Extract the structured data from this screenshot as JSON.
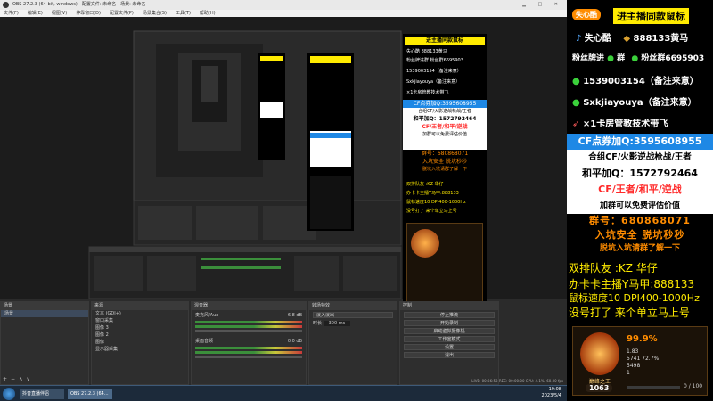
{
  "window": {
    "title": "OBS 27.2.3 (64-bit, windows) - 配置文件: 未命名 - 场景: 未命名",
    "menu": [
      "文件(F)",
      "编辑(E)",
      "视图(V)",
      "停靠窗口(D)",
      "配置文件(P)",
      "场景集合(S)",
      "工具(T)",
      "帮助(H)"
    ]
  },
  "chat": {
    "header": "进主播同款鼠标",
    "line1_name": "失心酷",
    "line1_val": "888133黄马",
    "line2": "粉丝牌进群",
    "line2_val": "粉丝群6695903",
    "qq": "1539003154（备注来意）",
    "wx": "Sxkjiayouya（备注来意）",
    "promo": "×1卡房管教技术带飞",
    "cf": "CF点券加Q:3595608955",
    "cf2": "合组CF/火影逆战枪战/王者",
    "cf3": "和平加Q：1572792464",
    "cf4": "CF/王者/和平/逆战",
    "cf5": "加群可以免费评估价值",
    "cf6": "群号：680868071",
    "cf7": "入坑安全 脱坑秒秒",
    "cf8": "脱坑入坑请群了解一下",
    "duo": "双排队友 :KZ 华仔",
    "anchor": "办卡卡主播Y马甲:888133",
    "mouse": "鼠标速度10 DPI400-1000Hz",
    "noshow": "没号打了 来个单立马上号"
  },
  "overlay": {
    "top_badge": "失心酷",
    "top_text": "进主播同款鼠标",
    "tiktok_name": "失心酷",
    "horse": "888133黄马",
    "fan_label": "粉丝牌进",
    "fan_mid": "群",
    "fan_group": "粉丝群6695903",
    "qq": "1539003154（备注来意）",
    "wx": "Sxkjiayouya（备注来意）",
    "promo": "×1卡房管教技术带飞",
    "cf_title": "CF点券加Q:3595608955",
    "cf_l2": "合组CF/火影逆战枪战/王者",
    "cf_l3": "和平加Q：1572792464",
    "cf_l4": "CF/王者/和平/逆战",
    "cf_l5": "加群可以免费评估价值",
    "cf_l6": "群号：680868071",
    "cf_l7": "入坑安全 脱坑秒秒",
    "cf_l8": "脱坑入坑请群了解一下",
    "duo": "双排队友 :KZ 华仔",
    "anchor": "办卡卡主播Y马甲:888133",
    "mouse": "鼠标速度10 DPI400-1000Hz",
    "noshow": "没号打了 来个单立马上号"
  },
  "card": {
    "percent": "99.9%",
    "rank_label": "巅峰之王",
    "score": "1063",
    "stats": [
      "1.83",
      "5741 72.7%",
      "5498",
      "1"
    ],
    "progress_text": "0 / 100"
  },
  "docks": {
    "scenes_title": "场景",
    "sources_title": "来源",
    "mixer_title": "混音器",
    "transitions_title": "转场特效",
    "controls_title": "控制",
    "scene_item": "场景",
    "sources": [
      "文本 (GDI+)",
      "窗口采集",
      "图像 3",
      "图像 2",
      "图像",
      "显示器采集"
    ],
    "mixer": [
      {
        "label": "麦克风/Aux",
        "db": "-6.8 dB"
      },
      {
        "label": "桌面音频",
        "db": "0.0 dB"
      }
    ],
    "transition": "淡入淡出",
    "duration_label": "时长",
    "duration": "300 ms",
    "controls": [
      "停止推流",
      "开始录制",
      "启动虚拟摄像机",
      "工作室模式",
      "设置",
      "退出"
    ],
    "status": "LIVE: 00:36:53   REC: 00:00:00   CPU: 4.1%, 60.00 fps"
  },
  "taskbar": {
    "apps": [
      "抖音直播伴侣",
      "OBS 27.2.3 (64..."
    ],
    "time": "19:08",
    "date": "2023/5/4"
  },
  "colors": {
    "yellow": "#ffeb00",
    "orange": "#ff8c00",
    "red": "#ff2a2a",
    "blue_bg": "#1e88e5",
    "white_bg": "#ffffff",
    "green": "#3bd13b"
  }
}
